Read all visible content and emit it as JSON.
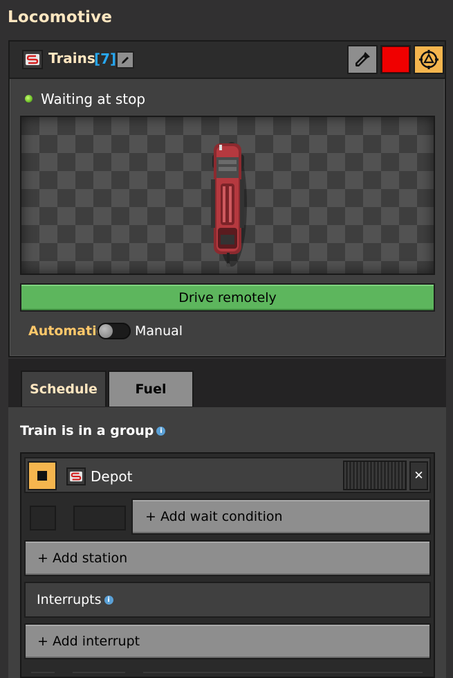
{
  "window": {
    "title": "Locomotive"
  },
  "header": {
    "group_name": "Trains",
    "group_count": "[7]",
    "icons": [
      "train-icon",
      "edit-icon",
      "color-picker-icon",
      "color-swatch",
      "select-target-icon"
    ],
    "selected_color": "#f00000"
  },
  "status": {
    "text": "Waiting at stop",
    "indicator_color": "#6fc02a"
  },
  "actions": {
    "drive_remotely": "Drive remotely"
  },
  "mode": {
    "automatic_label": "Automatic",
    "manual_label": "Manual",
    "selected": "Automatic"
  },
  "tabs": [
    {
      "label": "Schedule",
      "active": true
    },
    {
      "label": "Fuel",
      "active": false
    }
  ],
  "schedule": {
    "group_label": "Train is in a group",
    "stations": [
      {
        "name": "Depot",
        "add_wait_condition": "+ Add wait condition"
      }
    ],
    "add_station": "+ Add station",
    "interrupts_label": "Interrupts",
    "add_interrupt": "+ Add interrupt"
  },
  "colors": {
    "accent": "#f5b54e",
    "green_button": "#5db65d",
    "title_text": "#ffe6c0",
    "count_blue": "#27a7f0"
  }
}
